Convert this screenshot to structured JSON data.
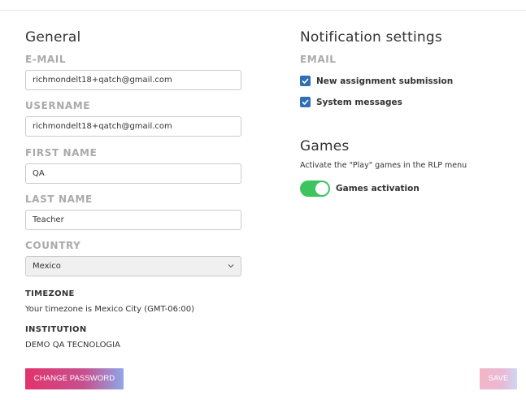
{
  "general": {
    "title": "General",
    "email_label": "E-MAIL",
    "email_value": "richmondelt18+qatch@gmail.com",
    "username_label": "USERNAME",
    "username_value": "richmondelt18+qatch@gmail.com",
    "first_name_label": "FIRST NAME",
    "first_name_value": "QA",
    "last_name_label": "LAST NAME",
    "last_name_value": "Teacher",
    "country_label": "COUNTRY",
    "country_value": "Mexico",
    "timezone_label": "TIMEZONE",
    "timezone_value": "Your timezone is Mexico City (GMT-06:00)",
    "institution_label": "INSTITUTION",
    "institution_value": "DEMO QA TECNOLOGIA",
    "change_password_label": "CHANGE PASSWORD"
  },
  "notifications": {
    "title": "Notification settings",
    "email_label": "EMAIL",
    "items": [
      {
        "label": "New assignment submission",
        "checked": true
      },
      {
        "label": "System messages",
        "checked": true
      }
    ]
  },
  "games": {
    "title": "Games",
    "description": "Activate the \"Play\" games in the RLP menu",
    "toggle_label": "Games activation",
    "enabled": true
  },
  "actions": {
    "save_label": "SAVE"
  },
  "colors": {
    "accent_pink": "#e2336b",
    "checkbox_blue": "#2f6fb4",
    "toggle_green": "#3ec45f"
  }
}
